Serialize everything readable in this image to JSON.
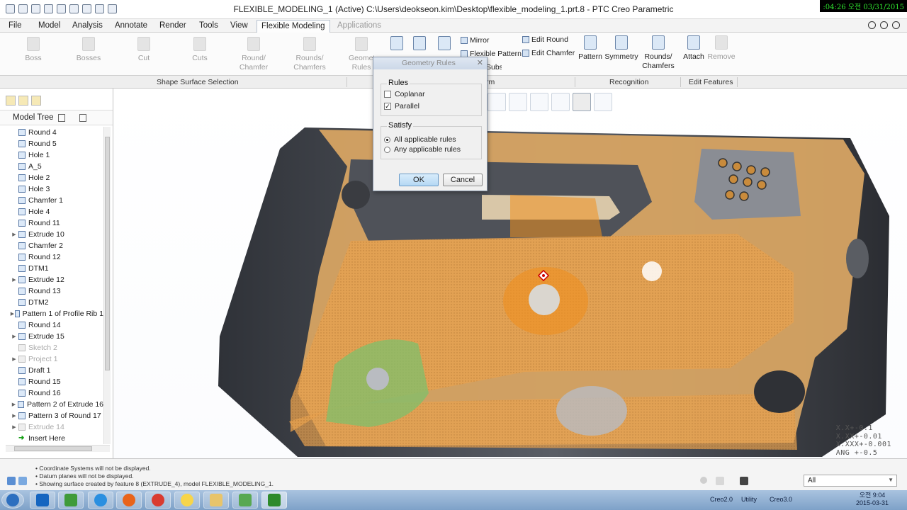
{
  "titlebar": {
    "title": "FLEXIBLE_MODELING_1 (Active) C:\\Users\\deokseon.kim\\Desktop\\flexible_modeling_1.prt.8 - PTC Creo Parametric",
    "recording_clock": ":04:26 오전 03/31/2015"
  },
  "menu_tabs": [
    "File",
    "Model",
    "Analysis",
    "Annotate",
    "Render",
    "Tools",
    "View",
    "Flexible Modeling",
    "Applications"
  ],
  "ribbon": {
    "shape_surface_selection": [
      "Boss",
      "Bosses",
      "Cut",
      "Cuts",
      "Round/ Chamfer",
      "Rounds/ Chamfers",
      "Geometry Rules"
    ],
    "transform_small": [
      "Mirror",
      "Flexible Pattern",
      "Substitute"
    ],
    "transform_edit": [
      "Edit Round",
      "Edit Chamfer"
    ],
    "transform_partial": "rm",
    "recognition": [
      "Pattern",
      "Symmetry",
      "Rounds/ Chamfers"
    ],
    "edit_features": [
      "Attach",
      "Remove"
    ],
    "groups": [
      "Shape Surface Selection",
      "Recognition",
      "Edit Features"
    ]
  },
  "model_tree": {
    "header": "Model Tree",
    "items": [
      {
        "label": "Round 4",
        "expand": false,
        "dim": false
      },
      {
        "label": "Round 5",
        "expand": false,
        "dim": false
      },
      {
        "label": "Hole 1",
        "expand": false,
        "dim": false
      },
      {
        "label": "A_5",
        "expand": false,
        "dim": false
      },
      {
        "label": "Hole 2",
        "expand": false,
        "dim": false
      },
      {
        "label": "Hole 3",
        "expand": false,
        "dim": false
      },
      {
        "label": "Chamfer 1",
        "expand": false,
        "dim": false
      },
      {
        "label": "Hole 4",
        "expand": false,
        "dim": false
      },
      {
        "label": "Round 11",
        "expand": false,
        "dim": false
      },
      {
        "label": "Extrude 10",
        "expand": true,
        "dim": false
      },
      {
        "label": "Chamfer 2",
        "expand": false,
        "dim": false
      },
      {
        "label": "Round 12",
        "expand": false,
        "dim": false
      },
      {
        "label": "DTM1",
        "expand": false,
        "dim": false
      },
      {
        "label": "Extrude 12",
        "expand": true,
        "dim": false
      },
      {
        "label": "Round 13",
        "expand": false,
        "dim": false
      },
      {
        "label": "DTM2",
        "expand": false,
        "dim": false
      },
      {
        "label": "Pattern 1 of Profile Rib 1",
        "expand": true,
        "dim": false
      },
      {
        "label": "Round 14",
        "expand": false,
        "dim": false
      },
      {
        "label": "Extrude 15",
        "expand": true,
        "dim": false
      },
      {
        "label": "Sketch 2",
        "expand": false,
        "dim": true
      },
      {
        "label": "Project 1",
        "expand": true,
        "dim": true
      },
      {
        "label": "Draft 1",
        "expand": false,
        "dim": false
      },
      {
        "label": "Round 15",
        "expand": false,
        "dim": false
      },
      {
        "label": "Round 16",
        "expand": false,
        "dim": false
      },
      {
        "label": "Pattern 2 of Extrude 16",
        "expand": true,
        "dim": false
      },
      {
        "label": "Pattern 3 of Round 17",
        "expand": true,
        "dim": false
      },
      {
        "label": "Extrude 14",
        "expand": true,
        "dim": true
      },
      {
        "label": "Insert Here",
        "expand": false,
        "dim": false,
        "insert": true
      }
    ]
  },
  "dialog": {
    "title": "Geometry Rules",
    "rules_legend": "Rules",
    "rules": [
      {
        "label": "Coplanar",
        "checked": false
      },
      {
        "label": "Parallel",
        "checked": true
      }
    ],
    "satisfy_legend": "Satisfy",
    "satisfy": [
      {
        "label": "All applicable rules",
        "selected": true
      },
      {
        "label": "Any applicable rules",
        "selected": false
      }
    ],
    "ok_label": "OK",
    "cancel_label": "Cancel"
  },
  "tolerances": [
    "X.X+-0.1",
    "X.XX+-0.01",
    "X.XXX+-0.001",
    "ANG +-0.5"
  ],
  "messages": [
    "Coordinate Systems will not be displayed.",
    "Datum planes will not be displayed.",
    "Showing surface created by feature 8 (EXTRUDE_4), model FLEXIBLE_MODELING_1."
  ],
  "filter": {
    "value": "All"
  },
  "taskbar": {
    "tray": [
      "Creo2.0",
      "Utility",
      "Creo3.0"
    ],
    "time": "오전 9:04",
    "date": "2015-03-31"
  },
  "colors": {
    "selection_orange": "#f0901e",
    "body_tan": "#d7a463",
    "body_dark": "#3e4148",
    "highlight_green": "#7fc06b"
  }
}
